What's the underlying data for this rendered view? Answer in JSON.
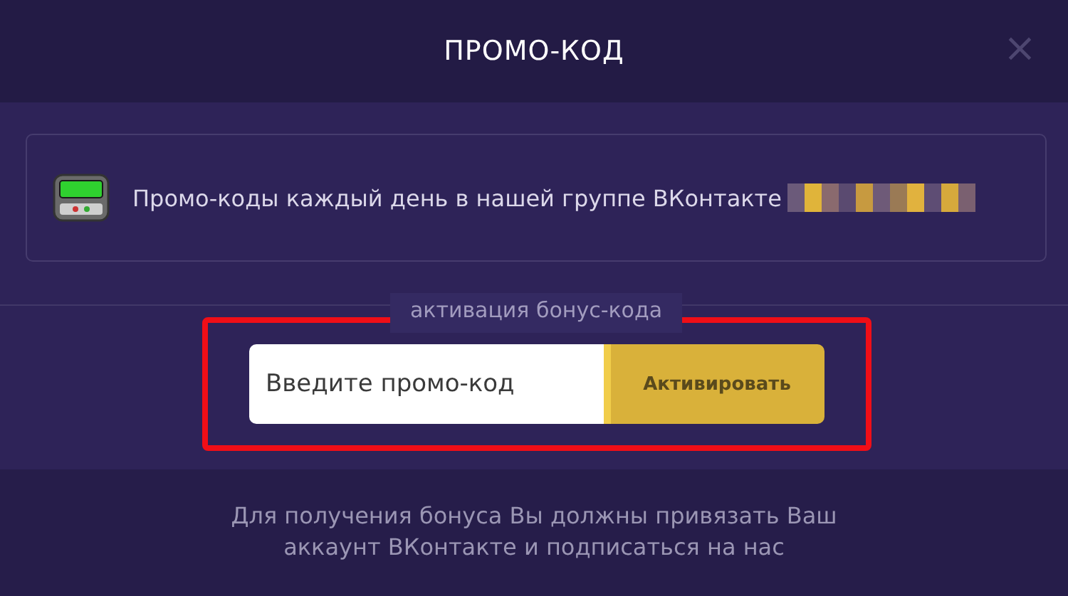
{
  "dialog": {
    "title": "ПРОМО-КОД",
    "close_label": "×"
  },
  "banner": {
    "text": "Промо-коды каждый день в нашей группе ВКонтакте"
  },
  "section_label": "активация бонус-кода",
  "promo_form": {
    "placeholder": "Введите промо-код",
    "button": "Активировать"
  },
  "footer_text": "Для получения бонуса Вы должны привязать Ваш аккаунт ВКонтакте и подписаться на нас"
}
